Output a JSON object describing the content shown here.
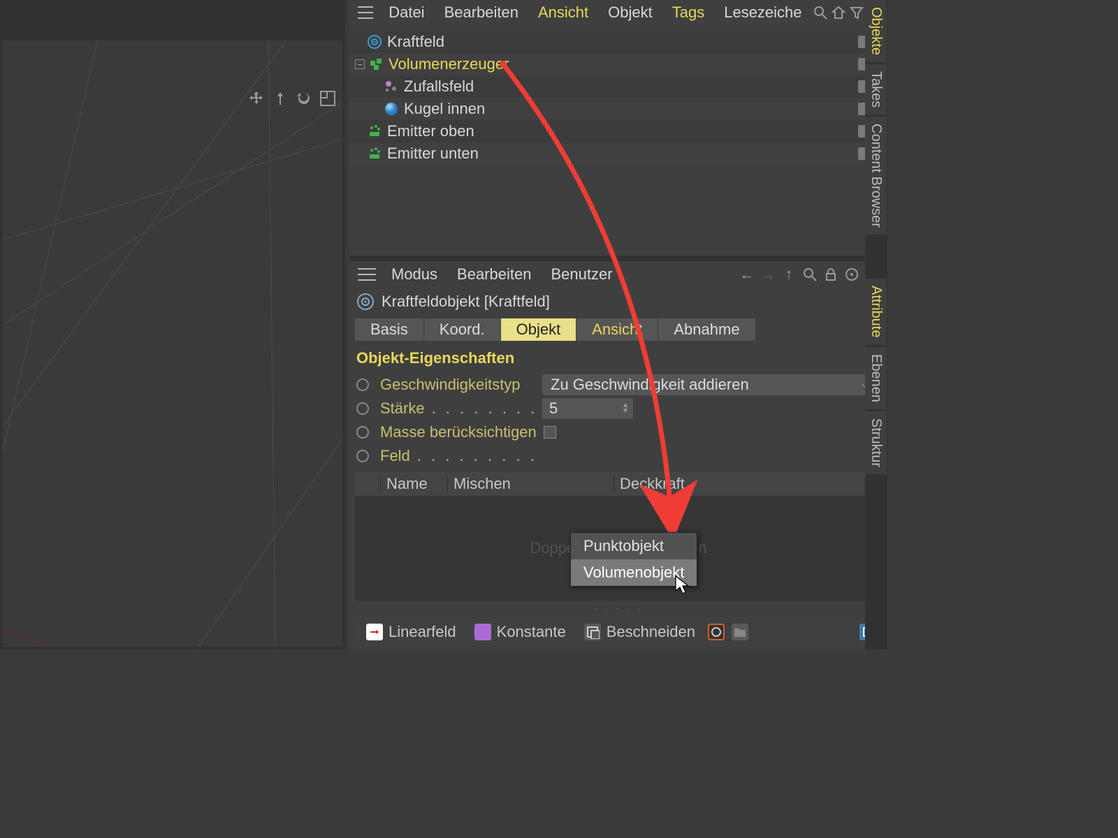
{
  "colors": {
    "accent": "#e8d85b",
    "annotation": "#ef3d36",
    "check": "#4fbf5f"
  },
  "objectManager": {
    "menu": {
      "items": [
        "Datei",
        "Bearbeiten",
        "Ansicht",
        "Objekt",
        "Tags",
        "Lesezeiche"
      ],
      "active_indices": [
        2,
        4
      ]
    },
    "tree": [
      {
        "label": "Kraftfeld",
        "indent": 24,
        "icon": "target",
        "selected": false,
        "expand": null
      },
      {
        "label": "Volumenerzeuger",
        "indent": 24,
        "icon": "volume",
        "selected": true,
        "expand": "minus"
      },
      {
        "label": "Zufallsfeld",
        "indent": 60,
        "icon": "random",
        "selected": false,
        "expand": null
      },
      {
        "label": "Kugel innen",
        "indent": 60,
        "icon": "sphere",
        "selected": false,
        "expand": null,
        "tags": 2
      },
      {
        "label": "Emitter oben",
        "indent": 24,
        "icon": "emitter",
        "selected": false,
        "expand": null
      },
      {
        "label": "Emitter unten",
        "indent": 24,
        "icon": "emitter",
        "selected": false,
        "expand": null
      }
    ]
  },
  "attributeManager": {
    "menu": {
      "items": [
        "Modus",
        "Bearbeiten",
        "Benutzer"
      ]
    },
    "header": "Kraftfeldobjekt [Kraftfeld]",
    "tabs": {
      "items": [
        "Basis",
        "Koord.",
        "Objekt",
        "Ansicht",
        "Abnahme"
      ],
      "active_index": 2,
      "alt_active_index": 3
    },
    "section_title": "Objekt-Eigenschaften",
    "props": {
      "speed_type_label": "Geschwindigkeitstyp",
      "speed_type_value": "Zu Geschwindigkeit addieren",
      "strength_label": "Stärke",
      "strength_value": "5",
      "mass_label": "Masse berücksichtigen",
      "mass_checked": false,
      "field_label": "Feld"
    },
    "field_table": {
      "headers": [
        "",
        "Name",
        "Mischen",
        "Deckkraft"
      ],
      "placeholder_full": "Doppelklick, um                     erzeugen"
    },
    "bottom_bar": {
      "linear": "Linearfeld",
      "constant": "Konstante",
      "clip": "Beschneiden"
    }
  },
  "popup": {
    "items": [
      "Punktobjekt",
      "Volumenobjekt"
    ],
    "hover_index": 1
  },
  "verticalTabs": {
    "top": [
      "Objekte",
      "Takes",
      "Content Browser"
    ],
    "bottom": [
      "Attribute",
      "Ebenen",
      "Struktur"
    ],
    "active_top": 0,
    "active_bottom": 0
  }
}
